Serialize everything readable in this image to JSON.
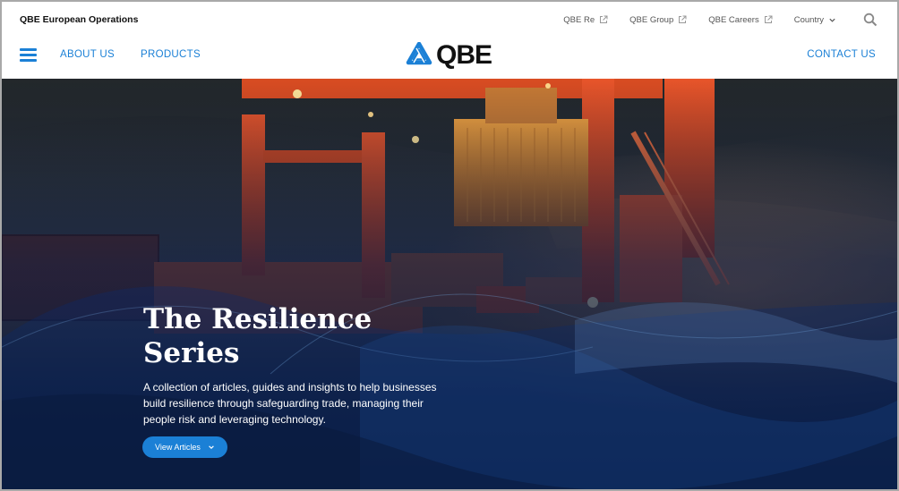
{
  "utility": {
    "site_name": "QBE European Operations",
    "links": [
      {
        "label": "QBE Re",
        "icon": "external-link-icon"
      },
      {
        "label": "QBE Group",
        "icon": "external-link-icon"
      },
      {
        "label": "QBE Careers",
        "icon": "external-link-icon"
      }
    ],
    "country_label": "Country",
    "search_icon": "search-icon"
  },
  "nav": {
    "about_label": "ABOUT US",
    "products_label": "PRODUCTS",
    "contact_label": "CONTACT US",
    "logo_text": "QBE"
  },
  "hero": {
    "title_line1": "The Resilience",
    "title_line2": "Series",
    "description": "A collection of articles, guides and insights to help businesses build resilience through safeguarding trade, managing their people risk and leveraging technology.",
    "cta_label": "View Articles"
  },
  "colors": {
    "brand_blue": "#1b80d6",
    "text_dark": "#111111",
    "text_muted": "#555555"
  }
}
